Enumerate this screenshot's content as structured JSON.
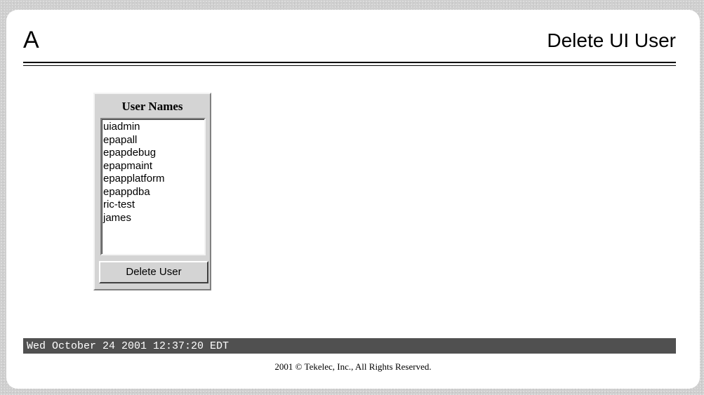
{
  "header": {
    "letter": "A",
    "title": "Delete UI User"
  },
  "user_panel": {
    "heading": "User Names",
    "users": [
      "uiadmin",
      "epapall",
      "epapdebug",
      "epapmaint",
      "epapplatform",
      "epappdba",
      "ric-test",
      "james"
    ],
    "delete_button_label": "Delete User"
  },
  "status_bar": {
    "datetime": "Wed October 24 2001 12:37:20 EDT"
  },
  "footer": {
    "copyright": "2001 © Tekelec, Inc., All Rights Reserved."
  },
  "colors": {
    "page_background": "#cfcfcf",
    "panel_background": "#ffffff",
    "status_bar": "#505050",
    "status_text": "#ffffff",
    "control_face": "#d4d4d4"
  }
}
